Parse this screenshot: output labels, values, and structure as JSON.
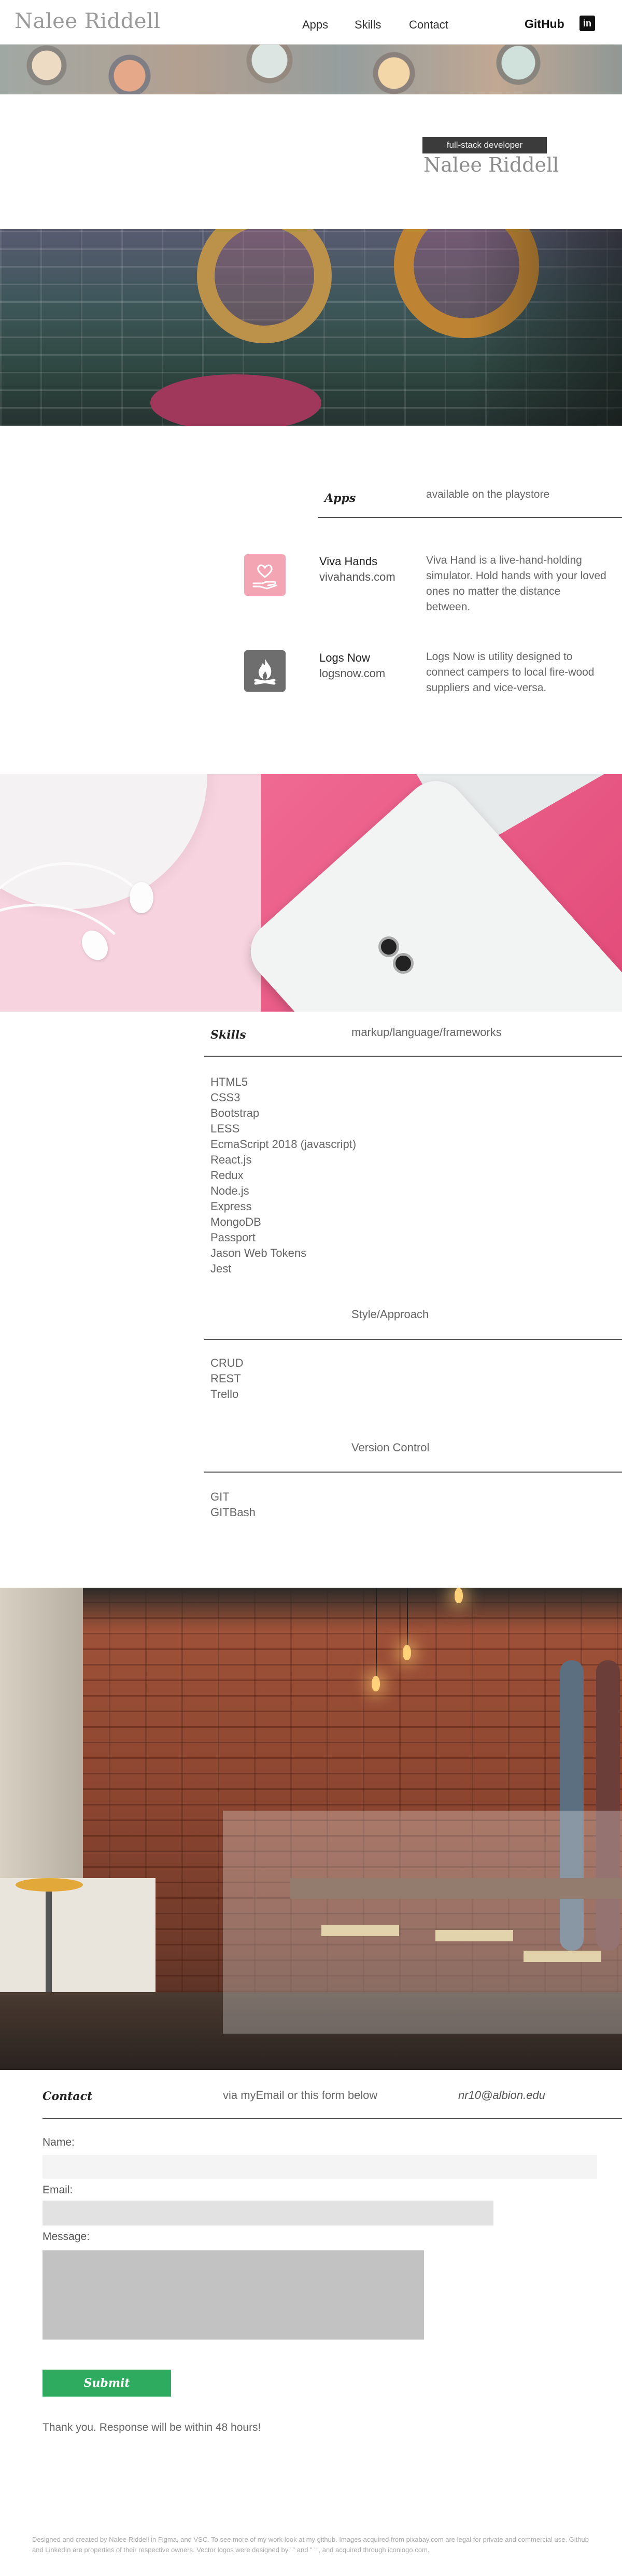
{
  "nav": {
    "brand": "Nalee Riddell",
    "links": [
      "Apps",
      "Skills",
      "Contact"
    ],
    "github": "GitHub",
    "linkedin_icon": "linkedin-icon"
  },
  "hero": {
    "tag": "full-stack developer",
    "name": "Nalee Riddell"
  },
  "apps": {
    "heading": "Apps",
    "subheading": "available on the playstore",
    "items": [
      {
        "icon": "heart-hand-icon",
        "icon_color": "#f4a5b3",
        "name": "Viva Hands",
        "url": "vivahands.com",
        "description": "Viva Hand is a live-hand-holding simulator. Hold hands with your loved ones no matter the distance between."
      },
      {
        "icon": "campfire-icon",
        "icon_color": "#6e6e6e",
        "name": "Logs Now",
        "url": "logsnow.com",
        "description": "Logs Now is utility designed to connect campers to local fire-wood suppliers and vice-versa."
      }
    ]
  },
  "skills": {
    "heading": "Skills",
    "subheading": "markup/language/frameworks",
    "items": [
      "HTML5",
      "CSS3",
      "Bootstrap",
      "LESS",
      "EcmaScript 2018 (javascript)",
      "React.js",
      "Redux",
      "Node.js",
      "Express",
      "MongoDB",
      "Passport",
      "Jason Web Tokens",
      "Jest"
    ],
    "style_heading": "Style/Approach",
    "style_items": [
      "CRUD",
      "REST",
      "Trello"
    ],
    "vc_heading": "Version Control",
    "vc_items": [
      "GIT",
      "GITBash"
    ]
  },
  "contact": {
    "heading": "Contact",
    "subheading": "via myEmail or this form below",
    "email": "nr10@albion.edu",
    "name_label": "Name:",
    "email_label": "Email:",
    "message_label": "Message:",
    "submit_label": "Submit",
    "thanks": "Thank you. Response will be within 48 hours!"
  },
  "footer": {
    "text": "Designed and created by Nalee Riddell in Figma, and VSC.   To see more of my work look at my github. Images acquired from pixabay.com are legal for private and commercial use. Github and LinkedIn are properties of their respective owners. Vector logos were designed by\" \" and \" \" , and acquired through iconlogo.com."
  },
  "colors": {
    "accent_green": "#2eab5f",
    "hero_tag_bg": "#3b3b3b",
    "rule": "#555555"
  }
}
